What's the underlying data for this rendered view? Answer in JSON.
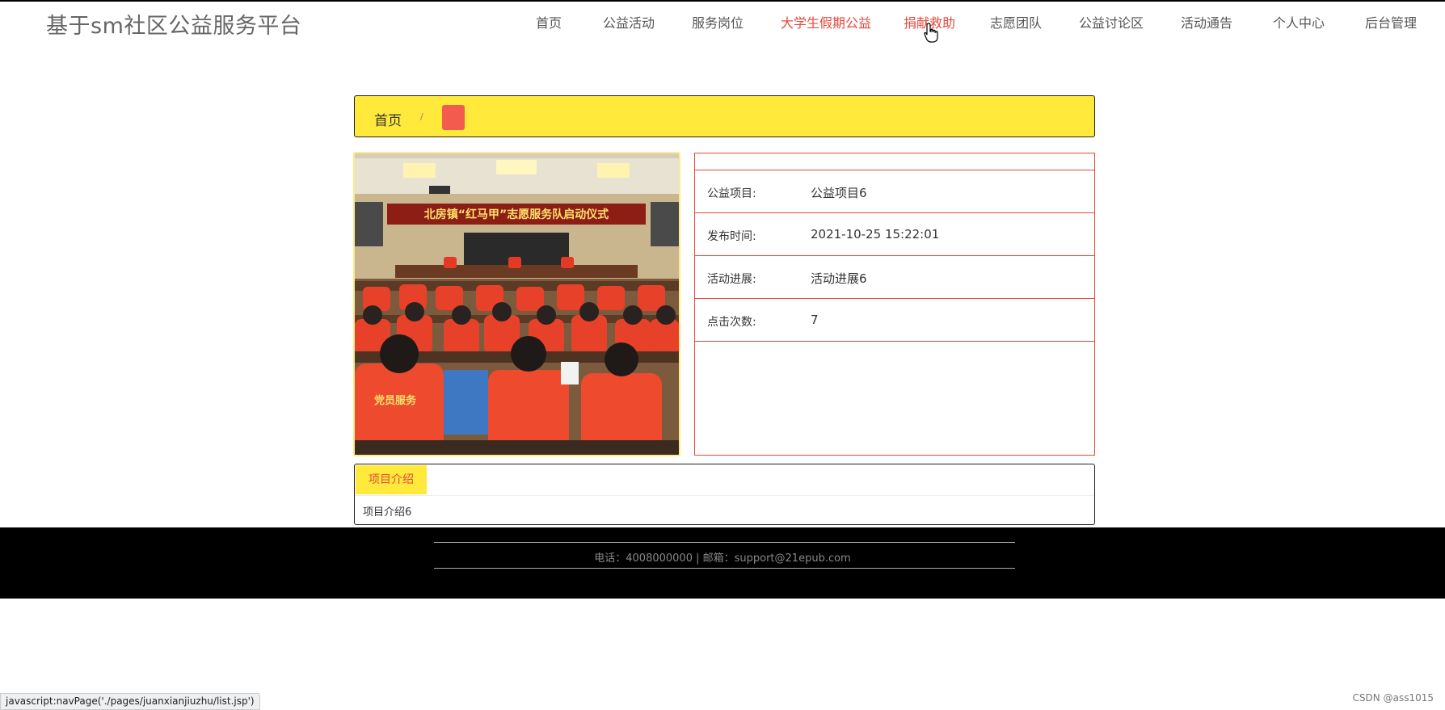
{
  "site": {
    "title": "基于sm社区公益服务平台"
  },
  "nav": [
    {
      "label": "首页",
      "active": false
    },
    {
      "label": "公益活动",
      "active": false
    },
    {
      "label": "服务岗位",
      "active": false
    },
    {
      "label": "大学生假期公益",
      "active": true
    },
    {
      "label": "捐献救助",
      "active": true
    },
    {
      "label": "志愿团队",
      "active": false
    },
    {
      "label": "公益讨论区",
      "active": false
    },
    {
      "label": "活动通告",
      "active": false
    },
    {
      "label": "个人中心",
      "active": false
    },
    {
      "label": "后台管理",
      "active": false
    }
  ],
  "breadcrumb": {
    "home": "首页",
    "separator": "/"
  },
  "photo": {
    "banner": "北房镇“红马甲”志愿服务队启动仪式",
    "vest_text": "党员服务"
  },
  "details": {
    "project": {
      "label": "公益项目:",
      "value": "公益项目6"
    },
    "publish_time": {
      "label": "发布时间:",
      "value": "2021-10-25 15:22:01"
    },
    "progress": {
      "label": "活动进展:",
      "value": "活动进展6"
    },
    "clicks": {
      "label": "点击次数:",
      "value": "7"
    }
  },
  "intro": {
    "tab_label": "项目介绍",
    "content": "项目介绍6"
  },
  "footer": {
    "contact": "电话：4008000000 | 邮箱：support@21epub.com"
  },
  "status_bar": {
    "url": "javascript:navPage('./pages/juanxianjiuzhu/list.jsp')"
  },
  "watermark": "CSDN @ass1015",
  "colors": {
    "accent_yellow": "#ffe93b",
    "accent_red": "#e8483c",
    "footer_bg": "#000000"
  }
}
